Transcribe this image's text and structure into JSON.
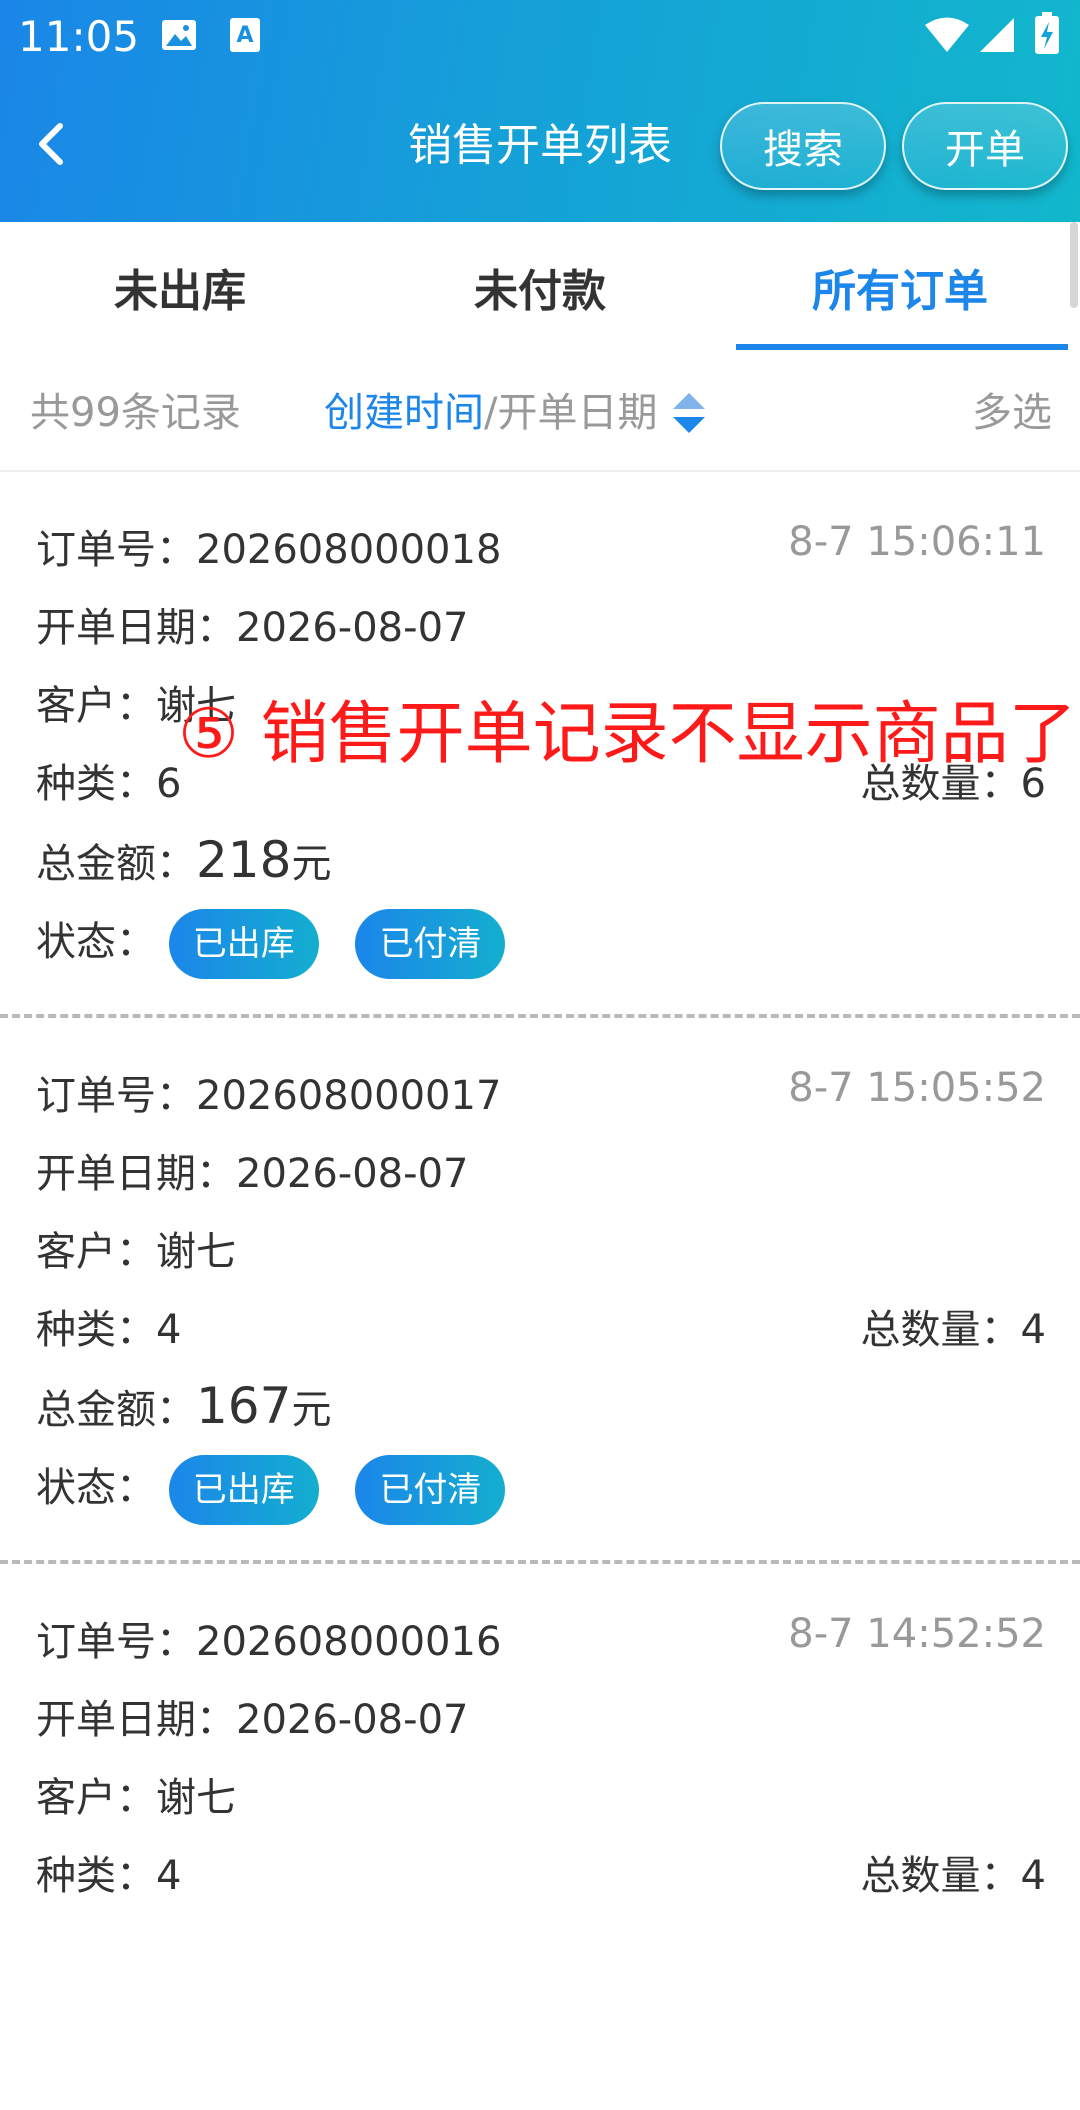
{
  "status_bar": {
    "time": "11:05"
  },
  "header": {
    "title": "销售开单列表",
    "search_label": "搜索",
    "create_label": "开单"
  },
  "tabs": [
    {
      "label": "未出库",
      "active": false
    },
    {
      "label": "未付款",
      "active": false
    },
    {
      "label": "所有订单",
      "active": true
    }
  ],
  "filter": {
    "count_text": "共99条记录",
    "sort_active": "创建时间",
    "sort_divider": "/",
    "sort_inactive": "开单日期",
    "multi_select": "多选"
  },
  "labels": {
    "order_no": "订单号：",
    "date": "开单日期：",
    "customer": "客户：",
    "kinds": "种类：",
    "total_qty": "总数量：",
    "total_amount": "总金额：",
    "status": "状态：",
    "currency": "元"
  },
  "orders": [
    {
      "order_no": "202608000018",
      "timestamp": "8-7 15:06:11",
      "date": "2026-08-07",
      "customer": "谢七",
      "kinds": "6",
      "total_qty": "6",
      "amount": "218",
      "status": [
        "已出库",
        "已付清"
      ]
    },
    {
      "order_no": "202608000017",
      "timestamp": "8-7 15:05:52",
      "date": "2026-08-07",
      "customer": "谢七",
      "kinds": "4",
      "total_qty": "4",
      "amount": "167",
      "status": [
        "已出库",
        "已付清"
      ]
    },
    {
      "order_no": "202608000016",
      "timestamp": "8-7 14:52:52",
      "date": "2026-08-07",
      "customer": "谢七",
      "kinds": "4",
      "total_qty": "4"
    }
  ],
  "annotation": "⑤ 销售开单记录不显示商品了",
  "colors": {
    "accent": "#1c86ea",
    "annotation": "#ff1a1a",
    "header_start": "#1a86e8",
    "header_end": "#12b7cc"
  }
}
